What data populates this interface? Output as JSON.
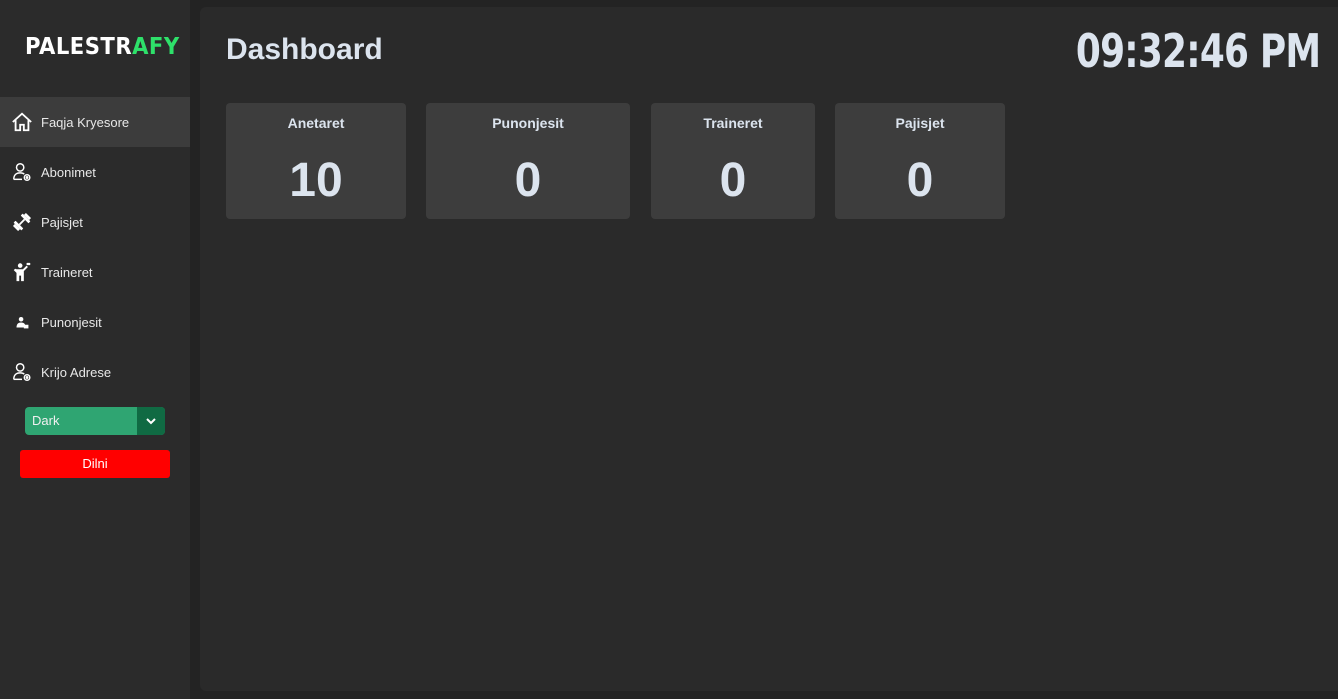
{
  "sidebar": {
    "logo": {
      "part1": "PALESTR",
      "part2": "AFY"
    },
    "items": [
      {
        "label": "Faqja Kryesore",
        "icon": "home-icon"
      },
      {
        "label": "Abonimet",
        "icon": "user-gear-icon"
      },
      {
        "label": "Pajisjet",
        "icon": "dumbbell-icon"
      },
      {
        "label": "Traineret",
        "icon": "trainer-icon"
      },
      {
        "label": "Punonjesit",
        "icon": "employee-icon"
      },
      {
        "label": "Krijo Adrese",
        "icon": "user-gear-icon"
      }
    ],
    "theme_select": {
      "value": "Dark"
    },
    "logout_label": "Dilni"
  },
  "main": {
    "title": "Dashboard",
    "clock": "09:32:46 PM",
    "cards": [
      {
        "title": "Anetaret",
        "value": "10"
      },
      {
        "title": "Punonjesit",
        "value": "0"
      },
      {
        "title": "Traineret",
        "value": "0"
      },
      {
        "title": "Pajisjet",
        "value": "0"
      }
    ]
  },
  "colors": {
    "accent_green": "#2ee06a",
    "select_bg": "#2fa572",
    "select_arrow_bg": "#106a43",
    "logout_red": "#ff0000",
    "active_nav": "#3c3c3c"
  }
}
